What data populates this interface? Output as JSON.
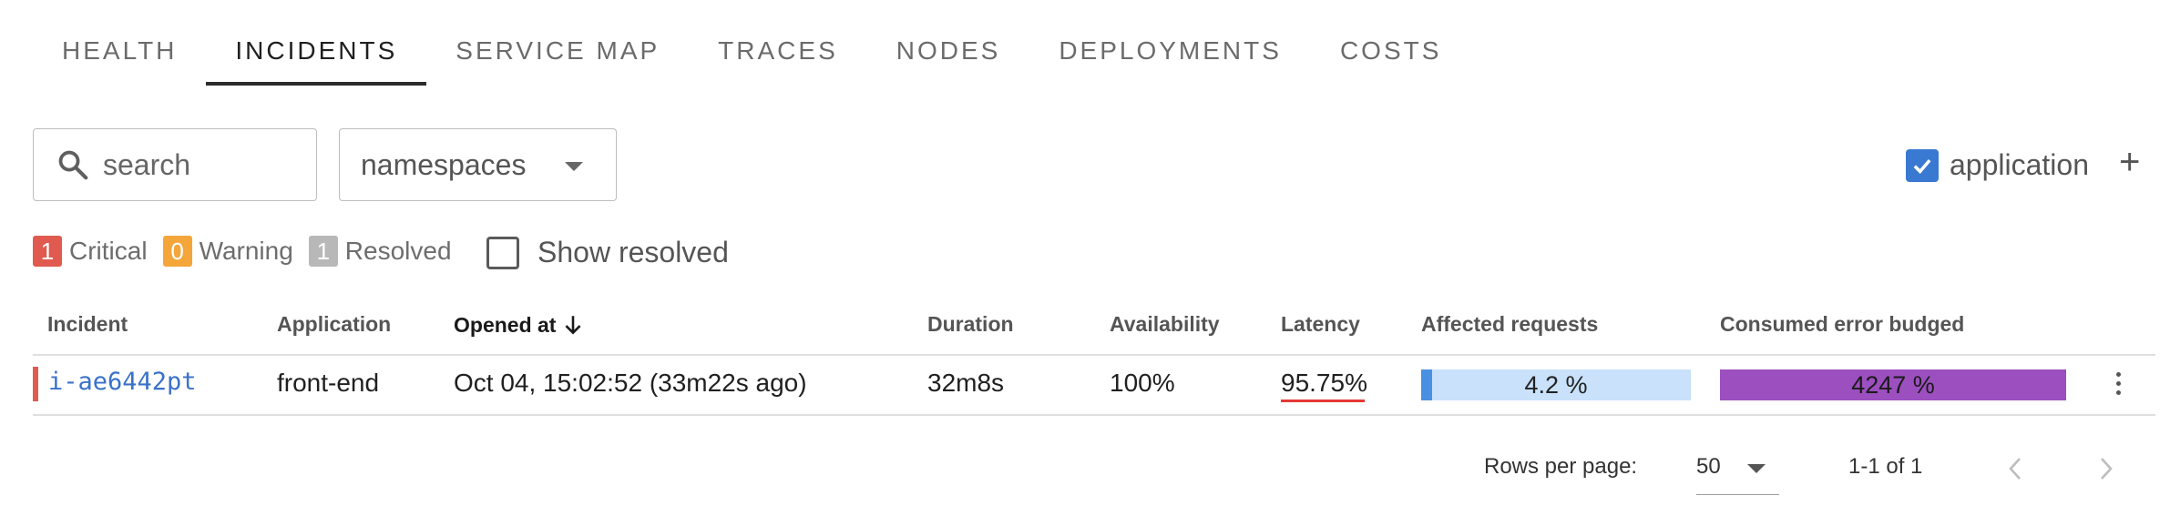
{
  "tabs": [
    {
      "label": "HEALTH"
    },
    {
      "label": "INCIDENTS"
    },
    {
      "label": "SERVICE MAP"
    },
    {
      "label": "TRACES"
    },
    {
      "label": "NODES"
    },
    {
      "label": "DEPLOYMENTS"
    },
    {
      "label": "COSTS"
    }
  ],
  "active_tab": "INCIDENTS",
  "filters": {
    "search_placeholder": "search",
    "namespaces_label": "namespaces",
    "application_label": "application",
    "application_checked": true,
    "add_icon": "plus-icon"
  },
  "status_counts": {
    "critical": {
      "count": "1",
      "label": "Critical",
      "color": "#e05a4f"
    },
    "warning": {
      "count": "0",
      "label": "Warning",
      "color": "#f4a63a"
    },
    "resolved": {
      "count": "1",
      "label": "Resolved",
      "color": "#b8b8b8"
    },
    "show_resolved_label": "Show resolved",
    "show_resolved_checked": false
  },
  "table": {
    "columns": [
      "Incident",
      "Application",
      "Opened at",
      "Duration",
      "Availability",
      "Latency",
      "Affected requests",
      "Consumed error budged"
    ],
    "sorted_column": "Opened at",
    "rows": [
      {
        "incident": "i-ae6442pt",
        "application": "front-end",
        "opened_at": "Oct 04, 15:02:52 (33m22s ago)",
        "duration": "32m8s",
        "availability": "100%",
        "latency": "95.75%",
        "affected_requests": "4.2 %",
        "affected_requests_value": 4.2,
        "consumed_error_budget": "4247 %",
        "consumed_error_budget_value": 4247
      }
    ]
  },
  "pagination": {
    "rows_per_page_label": "Rows per page:",
    "rows_per_page": "50",
    "range": "1-1 of 1"
  }
}
